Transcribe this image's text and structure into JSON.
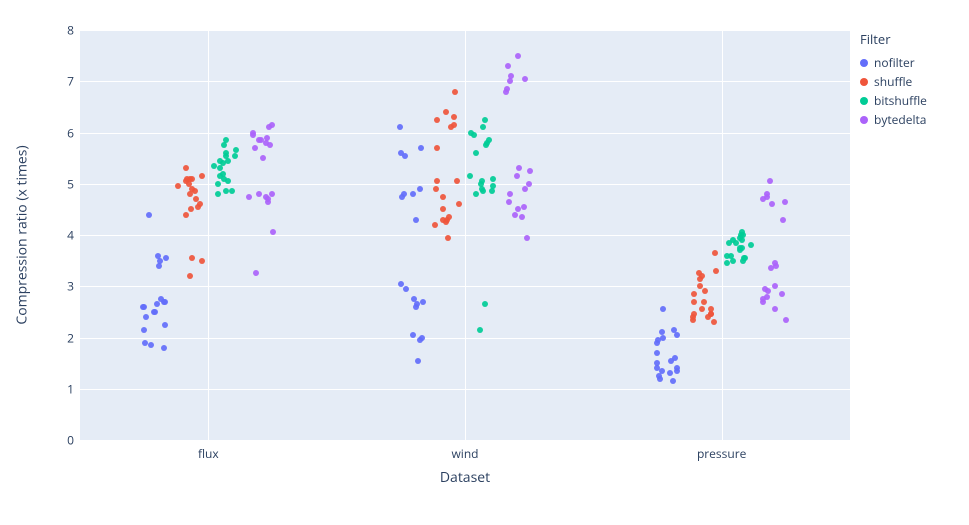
{
  "chart_data": {
    "type": "scatter",
    "xlabel": "Dataset",
    "ylabel": "Compression ratio (x times)",
    "categories": [
      "flux",
      "wind",
      "pressure"
    ],
    "legend_title": "Filter",
    "ylim": [
      0,
      8
    ],
    "yticks": [
      0,
      1,
      2,
      3,
      4,
      5,
      6,
      7,
      8
    ],
    "series": [
      {
        "name": "nofilter",
        "color": "#636efa",
        "points": {
          "flux": [
            1.8,
            1.9,
            1.85,
            2.15,
            2.25,
            2.4,
            2.5,
            2.5,
            2.6,
            2.6,
            2.75,
            2.7,
            2.7,
            2.65,
            3.4,
            3.5,
            3.55,
            3.6,
            4.4
          ],
          "wind": [
            1.55,
            1.95,
            2.0,
            2.05,
            2.6,
            2.65,
            2.7,
            2.75,
            2.95,
            3.05,
            4.3,
            4.8,
            4.75,
            4.8,
            4.9,
            5.55,
            5.7,
            5.6,
            6.1
          ],
          "pressure": [
            1.15,
            1.2,
            1.25,
            1.3,
            1.35,
            1.35,
            1.4,
            1.4,
            1.5,
            1.6,
            1.55,
            1.7,
            1.9,
            1.95,
            2.0,
            2.05,
            2.1,
            2.15,
            2.55
          ]
        }
      },
      {
        "name": "shuffle",
        "color": "#ef553b",
        "points": {
          "flux": [
            3.2,
            3.5,
            3.55,
            4.4,
            4.5,
            4.55,
            4.6,
            4.7,
            4.8,
            4.85,
            4.9,
            4.95,
            5.0,
            5.05,
            5.1,
            5.1,
            5.1,
            5.15,
            5.3
          ],
          "wind": [
            3.95,
            4.2,
            4.25,
            4.3,
            4.3,
            4.35,
            4.5,
            4.6,
            4.75,
            4.9,
            5.05,
            5.05,
            5.7,
            6.1,
            6.15,
            6.25,
            6.3,
            6.4,
            6.8
          ],
          "pressure": [
            2.3,
            2.35,
            2.4,
            2.4,
            2.45,
            2.45,
            2.45,
            2.55,
            2.55,
            2.7,
            2.7,
            2.85,
            2.9,
            3.0,
            3.15,
            3.2,
            3.25,
            3.3,
            3.65
          ]
        }
      },
      {
        "name": "bitshuffle",
        "color": "#00cc96",
        "points": {
          "flux": [
            4.8,
            4.85,
            4.85,
            5.0,
            5.05,
            5.1,
            5.15,
            5.2,
            5.3,
            5.35,
            5.4,
            5.45,
            5.45,
            5.55,
            5.55,
            5.6,
            5.65,
            5.75,
            5.85
          ],
          "wind": [
            2.15,
            2.65,
            4.8,
            4.85,
            4.85,
            4.9,
            4.95,
            5.0,
            5.05,
            5.1,
            5.15,
            5.6,
            5.75,
            5.8,
            5.85,
            5.95,
            6.0,
            6.1,
            6.25
          ],
          "pressure": [
            3.45,
            3.5,
            3.5,
            3.55,
            3.55,
            3.6,
            3.6,
            3.7,
            3.75,
            3.75,
            3.8,
            3.85,
            3.85,
            3.9,
            3.9,
            3.95,
            4.0,
            4.0,
            4.05
          ]
        }
      },
      {
        "name": "bytedelta",
        "color": "#ab63fa",
        "points": {
          "flux": [
            3.25,
            4.05,
            4.65,
            4.7,
            4.75,
            4.75,
            4.8,
            4.8,
            5.5,
            5.7,
            5.75,
            5.8,
            5.85,
            5.85,
            5.9,
            5.95,
            6.0,
            6.1,
            6.15
          ],
          "wind": [
            3.95,
            4.35,
            4.4,
            4.5,
            4.55,
            4.65,
            4.8,
            4.9,
            5.0,
            5.15,
            5.25,
            5.3,
            6.8,
            6.85,
            7.0,
            7.05,
            7.1,
            7.3,
            7.5
          ],
          "pressure": [
            2.35,
            2.55,
            2.7,
            2.75,
            2.8,
            2.85,
            2.9,
            2.95,
            3.0,
            3.35,
            3.4,
            3.45,
            4.3,
            4.6,
            4.65,
            4.7,
            4.75,
            4.8,
            5.05
          ]
        }
      }
    ]
  }
}
